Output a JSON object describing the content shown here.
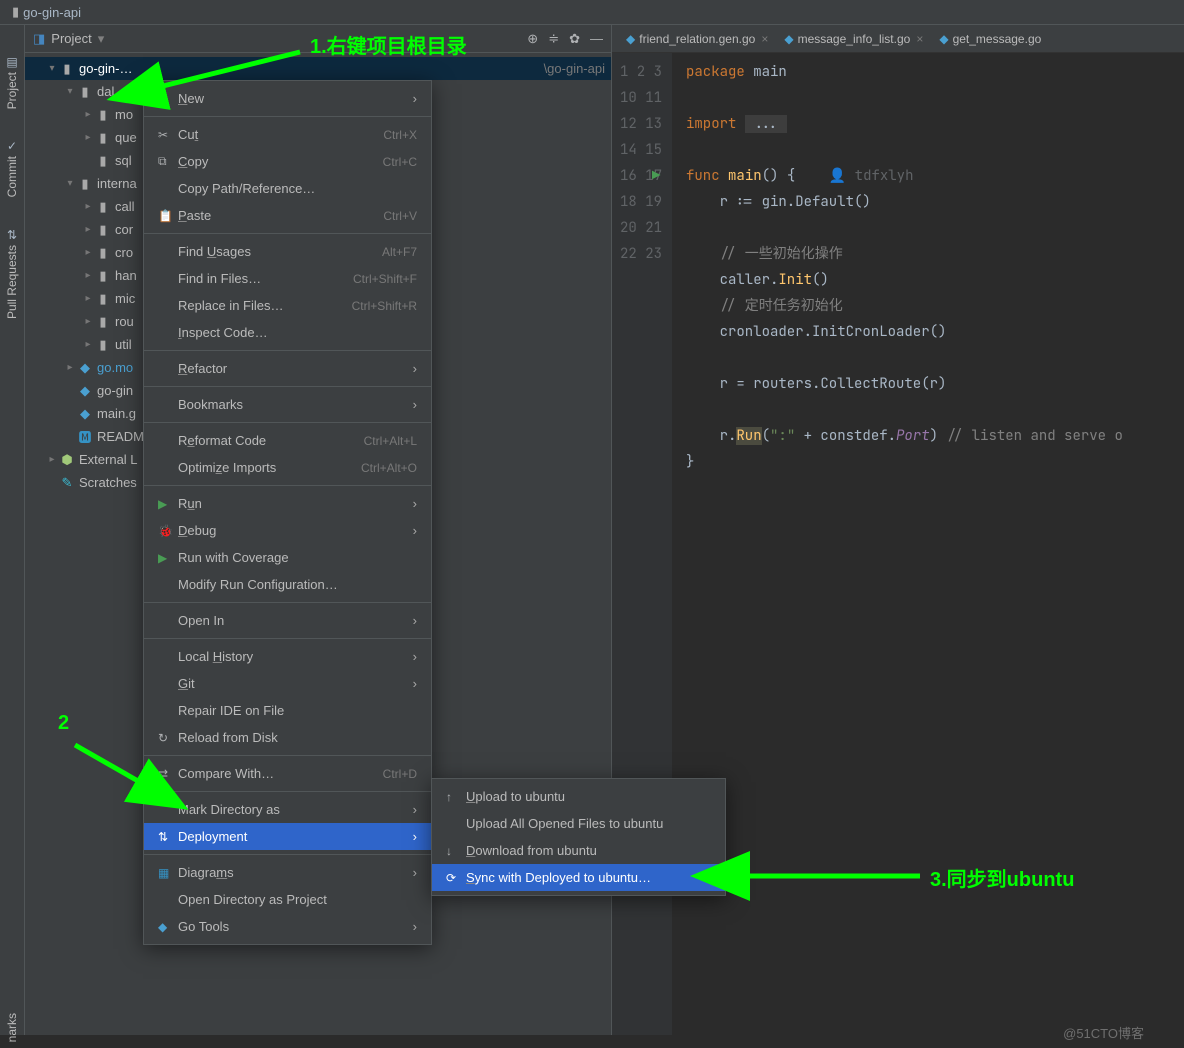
{
  "titlebar": {
    "project_name": "go-gin-api"
  },
  "toolstripe": {
    "project": "Project",
    "commit": "Commit",
    "pull": "Pull Requests"
  },
  "project_header": {
    "label": "Project"
  },
  "tree": {
    "root": "go-gin-…",
    "dal": "dal",
    "mo": "mo",
    "que": "que",
    "sql": "sql",
    "internal": "interna",
    "call": "call",
    "cor": "cor",
    "cro": "cro",
    "han": "han",
    "mic": "mic",
    "rou": "rou",
    "util": "util",
    "gomod": "go.mo",
    "gogin": "go-gin",
    "maing": "main.g",
    "readme": "READM",
    "ext": "External L",
    "scratch": "Scratches"
  },
  "tabs": {
    "t1": "friend_relation.gen.go",
    "t2": "message_info_list.go",
    "t3": "get_message.go"
  },
  "code": {
    "hint_author": "tdfxlyh",
    "folded": "..."
  },
  "breadcrumb_suffix": "\\go-gin-api",
  "ctx": {
    "new": "New",
    "cut": "Cut",
    "cut_sc": "Ctrl+X",
    "copy": "Copy",
    "copy_sc": "Ctrl+C",
    "copypath": "Copy Path/Reference…",
    "paste": "Paste",
    "paste_sc": "Ctrl+V",
    "findusages": "Find Usages",
    "findusages_sc": "Alt+F7",
    "findinfiles": "Find in Files…",
    "findinfiles_sc": "Ctrl+Shift+F",
    "replace": "Replace in Files…",
    "replace_sc": "Ctrl+Shift+R",
    "inspect": "Inspect Code…",
    "refactor": "Refactor",
    "bookmarks": "Bookmarks",
    "reformat": "Reformat Code",
    "reformat_sc": "Ctrl+Alt+L",
    "optimize": "Optimize Imports",
    "optimize_sc": "Ctrl+Alt+O",
    "run": "Run",
    "debug": "Debug",
    "coverage": "Run with Coverage",
    "modifyrun": "Modify Run Configuration…",
    "openin": "Open In",
    "localhistory": "Local History",
    "git": "Git",
    "repairide": "Repair IDE on File",
    "reload": "Reload from Disk",
    "compare": "Compare With…",
    "compare_sc": "Ctrl+D",
    "markdir": "Mark Directory as",
    "deployment": "Deployment",
    "diagrams": "Diagrams",
    "opendir": "Open Directory as Project",
    "gotools": "Go Tools"
  },
  "sub": {
    "upload": "Upload to ubuntu",
    "uploadall": "Upload All Opened Files to ubuntu",
    "download": "Download from ubuntu",
    "sync": "Sync with Deployed to ubuntu…"
  },
  "anno": {
    "a1": "1.右键项目根目录",
    "a2": "2",
    "a3": "3.同步到ubuntu"
  },
  "watermark": "@51CTO博客",
  "marks": "narks"
}
